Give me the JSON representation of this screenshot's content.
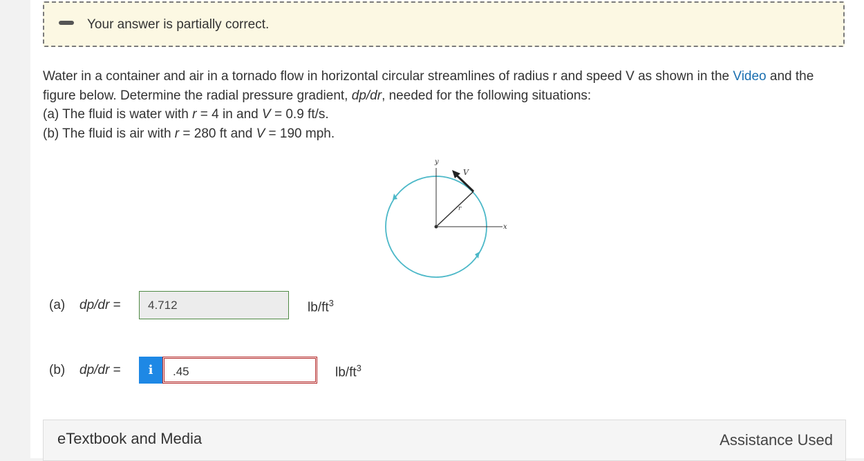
{
  "feedback": {
    "message": "Your answer is partially correct."
  },
  "question": {
    "intro_before_link": "Water in a container and air in a tornado flow in horizontal circular streamlines of radius r and speed V as shown in the ",
    "link": "Video",
    "intro_after_link_line1_end": " and the",
    "line2": "figure below. Determine the radial pressure gradient, ",
    "line2_var": "dp/dr",
    "line2_end": ", needed for the following situations:",
    "part_a_label": "(a)",
    "part_a_text": " The fluid is water with ",
    "part_a_r": "r",
    "part_a_mid": " = 4 in and ",
    "part_a_v": "V",
    "part_a_end": " = 0.9 ft/s.",
    "part_b_label": "(b)",
    "part_b_text": " The fluid is air with ",
    "part_b_r": "r",
    "part_b_mid": " = 280 ft and ",
    "part_b_v": "V",
    "part_b_end": " = 190 mph."
  },
  "figure": {
    "y_label": "y",
    "x_label": "x",
    "v_label": "V",
    "r_label": "r",
    "circle_color": "#4cb8c8"
  },
  "answers": {
    "a": {
      "label": "(a)",
      "var": "dp/dr",
      "eq": "=",
      "value": "4.712",
      "unit": "lb/ft",
      "unit_exp": "3",
      "status": "correct"
    },
    "b": {
      "label": "(b)",
      "var": "dp/dr",
      "eq": "=",
      "info_icon": "i",
      "value": ".45",
      "unit": "lb/ft",
      "unit_exp": "3",
      "status": "incorrect"
    }
  },
  "etextbook": {
    "title": "eTextbook and Media",
    "assistance": "Assistance Used"
  },
  "colors": {
    "feedback_bg": "#fcf8e3",
    "link": "#1a6fb0",
    "correct_border": "#4f8a45",
    "incorrect_border": "#b22222",
    "info_button": "#1e88e5"
  }
}
